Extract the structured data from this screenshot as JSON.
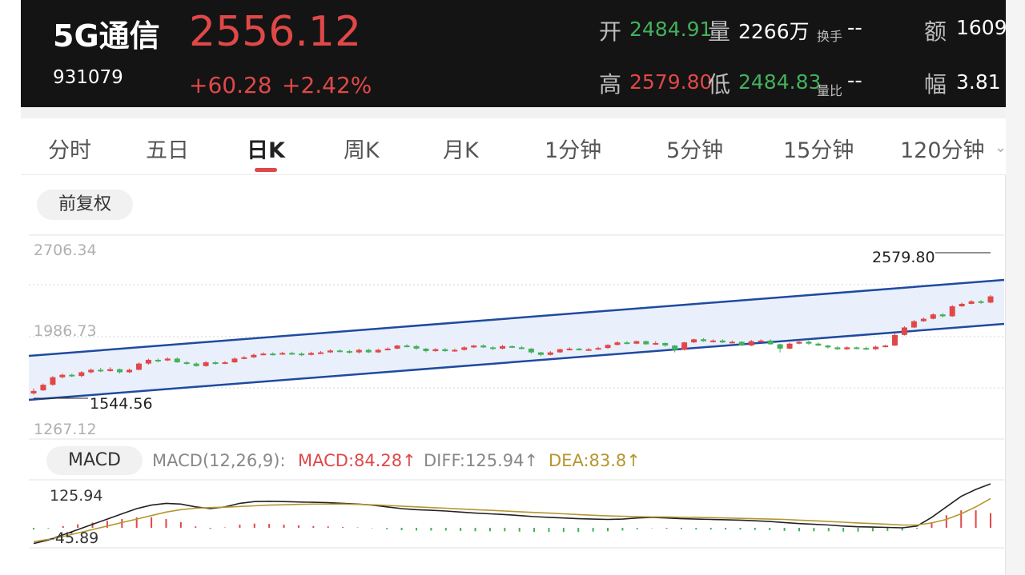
{
  "header": {
    "name": "5G通信",
    "code": "931079",
    "price": "2556.12",
    "change": "+60.28",
    "change_pct": "+2.42%",
    "open_label": "开",
    "open": "2484.91",
    "volume_label": "量",
    "volume": "2266万",
    "turnover_label": "换手",
    "turnover": "--",
    "amount_label": "额",
    "amount": "1609",
    "high_label": "高",
    "high": "2579.80",
    "low_label": "低",
    "low": "2484.83",
    "vol_ratio_label": "量比",
    "vol_ratio": "--",
    "amplitude_label": "幅",
    "amplitude": "3.81"
  },
  "tabs": [
    {
      "label": "分时"
    },
    {
      "label": "五日"
    },
    {
      "label": "日K",
      "active": true
    },
    {
      "label": "周K"
    },
    {
      "label": "月K"
    },
    {
      "label": "1分钟"
    },
    {
      "label": "5分钟"
    },
    {
      "label": "15分钟"
    },
    {
      "label": "120分钟"
    }
  ],
  "adjust": "前复权",
  "macd": {
    "label": "MACD",
    "params": "MACD(12,26,9):",
    "macd": "MACD:84.28↑",
    "diff": "DIFF:125.94↑",
    "dea": "DEA:83.8↑"
  },
  "colors": {
    "up": "#e04848",
    "down": "#44b05c",
    "channel": "#1f4aa0",
    "dea": "#b5962f"
  },
  "chart_data": {
    "type": "candlestick",
    "price_axis_labels": [
      "2706.34",
      "1986.73",
      "1267.12"
    ],
    "ylim": [
      1267.12,
      2706.34
    ],
    "max_marker": "2579.80",
    "min_marker": "1544.56",
    "candles": [
      [
        1550,
        1570,
        1540,
        1590
      ],
      [
        1575,
        1620,
        1570,
        1630
      ],
      [
        1620,
        1680,
        1610,
        1690
      ],
      [
        1680,
        1700,
        1670,
        1710
      ],
      [
        1700,
        1690,
        1680,
        1710
      ],
      [
        1690,
        1720,
        1680,
        1730
      ],
      [
        1720,
        1740,
        1710,
        1750
      ],
      [
        1740,
        1730,
        1720,
        1755
      ],
      [
        1730,
        1745,
        1725,
        1760
      ],
      [
        1745,
        1720,
        1710,
        1750
      ],
      [
        1720,
        1740,
        1715,
        1750
      ],
      [
        1740,
        1790,
        1735,
        1800
      ],
      [
        1790,
        1820,
        1780,
        1830
      ],
      [
        1820,
        1815,
        1800,
        1830
      ],
      [
        1815,
        1830,
        1810,
        1840
      ],
      [
        1830,
        1800,
        1795,
        1840
      ],
      [
        1800,
        1790,
        1780,
        1810
      ],
      [
        1790,
        1770,
        1765,
        1800
      ],
      [
        1770,
        1800,
        1765,
        1810
      ],
      [
        1800,
        1790,
        1780,
        1810
      ],
      [
        1790,
        1800,
        1785,
        1810
      ],
      [
        1800,
        1830,
        1795,
        1840
      ],
      [
        1830,
        1840,
        1825,
        1850
      ],
      [
        1840,
        1860,
        1835,
        1870
      ],
      [
        1860,
        1870,
        1855,
        1880
      ],
      [
        1870,
        1865,
        1855,
        1880
      ],
      [
        1865,
        1875,
        1860,
        1885
      ],
      [
        1875,
        1870,
        1860,
        1885
      ],
      [
        1870,
        1860,
        1850,
        1880
      ],
      [
        1860,
        1875,
        1855,
        1885
      ],
      [
        1875,
        1880,
        1870,
        1890
      ],
      [
        1880,
        1895,
        1875,
        1905
      ],
      [
        1895,
        1890,
        1880,
        1905
      ],
      [
        1890,
        1880,
        1870,
        1900
      ],
      [
        1880,
        1900,
        1870,
        1910
      ],
      [
        1900,
        1880,
        1875,
        1910
      ],
      [
        1880,
        1900,
        1875,
        1910
      ],
      [
        1900,
        1910,
        1895,
        1920
      ],
      [
        1910,
        1935,
        1905,
        1940
      ],
      [
        1935,
        1930,
        1920,
        1945
      ],
      [
        1930,
        1910,
        1900,
        1940
      ],
      [
        1910,
        1890,
        1880,
        1915
      ],
      [
        1890,
        1905,
        1885,
        1915
      ],
      [
        1905,
        1890,
        1885,
        1915
      ],
      [
        1890,
        1900,
        1885,
        1910
      ],
      [
        1900,
        1920,
        1895,
        1930
      ],
      [
        1920,
        1935,
        1915,
        1940
      ],
      [
        1935,
        1920,
        1915,
        1945
      ],
      [
        1920,
        1910,
        1900,
        1930
      ],
      [
        1910,
        1930,
        1905,
        1940
      ],
      [
        1930,
        1920,
        1915,
        1935
      ],
      [
        1920,
        1910,
        1905,
        1930
      ],
      [
        1910,
        1880,
        1870,
        1915
      ],
      [
        1880,
        1860,
        1850,
        1885
      ],
      [
        1860,
        1880,
        1855,
        1890
      ],
      [
        1880,
        1905,
        1875,
        1910
      ],
      [
        1905,
        1910,
        1895,
        1920
      ],
      [
        1910,
        1900,
        1895,
        1915
      ],
      [
        1900,
        1905,
        1895,
        1915
      ],
      [
        1905,
        1915,
        1900,
        1925
      ],
      [
        1915,
        1940,
        1910,
        1945
      ],
      [
        1940,
        1960,
        1935,
        1970
      ],
      [
        1960,
        1950,
        1945,
        1970
      ],
      [
        1950,
        1970,
        1945,
        1975
      ],
      [
        1970,
        1945,
        1940,
        1975
      ],
      [
        1945,
        1955,
        1940,
        1970
      ],
      [
        1955,
        1935,
        1925,
        1960
      ],
      [
        1935,
        1900,
        1880,
        1940
      ],
      [
        1900,
        1960,
        1895,
        1965
      ],
      [
        1960,
        1985,
        1955,
        1990
      ],
      [
        1985,
        1970,
        1965,
        1995
      ],
      [
        1970,
        1975,
        1960,
        1985
      ],
      [
        1975,
        1960,
        1955,
        1985
      ],
      [
        1960,
        1965,
        1955,
        1975
      ],
      [
        1965,
        1935,
        1930,
        1970
      ],
      [
        1935,
        1970,
        1930,
        1980
      ],
      [
        1970,
        1975,
        1965,
        1985
      ],
      [
        1975,
        1945,
        1940,
        1985
      ],
      [
        1945,
        1910,
        1880,
        1950
      ],
      [
        1910,
        1950,
        1905,
        1960
      ],
      [
        1950,
        1965,
        1945,
        1970
      ],
      [
        1965,
        1950,
        1940,
        1975
      ],
      [
        1950,
        1935,
        1930,
        1960
      ],
      [
        1935,
        1920,
        1910,
        1940
      ],
      [
        1920,
        1905,
        1900,
        1930
      ],
      [
        1905,
        1920,
        1900,
        1930
      ],
      [
        1920,
        1915,
        1905,
        1925
      ],
      [
        1915,
        1905,
        1900,
        1925
      ],
      [
        1905,
        1925,
        1900,
        1935
      ],
      [
        1925,
        1935,
        1920,
        1940
      ],
      [
        1935,
        2020,
        1930,
        2030
      ],
      [
        2020,
        2080,
        2015,
        2090
      ],
      [
        2080,
        2130,
        2075,
        2140
      ],
      [
        2130,
        2150,
        2125,
        2160
      ],
      [
        2150,
        2185,
        2145,
        2195
      ],
      [
        2185,
        2170,
        2160,
        2195
      ],
      [
        2170,
        2250,
        2165,
        2260
      ],
      [
        2250,
        2270,
        2245,
        2280
      ],
      [
        2270,
        2290,
        2265,
        2300
      ],
      [
        2290,
        2280,
        2270,
        2300
      ],
      [
        2280,
        2330,
        2275,
        2340
      ]
    ],
    "macd_axis_labels": [
      "125.94",
      "-45.89"
    ],
    "macd_ylim": [
      -45.89,
      125.94
    ],
    "diff": [
      -45,
      -35,
      -20,
      -5,
      10,
      25,
      40,
      55,
      65,
      70,
      68,
      60,
      55,
      60,
      70,
      75,
      76,
      75,
      74,
      73,
      72,
      70,
      68,
      65,
      60,
      55,
      52,
      50,
      48,
      45,
      42,
      40,
      38,
      35,
      32,
      30,
      28,
      26,
      25,
      24,
      25,
      28,
      30,
      28,
      26,
      25,
      24,
      23,
      22,
      20,
      18,
      15,
      12,
      10,
      8,
      5,
      3,
      2,
      1,
      0,
      5,
      30,
      60,
      90,
      110,
      125.94
    ],
    "dea": [
      -40,
      -33,
      -25,
      -15,
      -5,
      5,
      15,
      25,
      35,
      45,
      52,
      56,
      58,
      59,
      61,
      63,
      65,
      66,
      67,
      68,
      68,
      68,
      67,
      66,
      64,
      62,
      60,
      58,
      56,
      54,
      52,
      50,
      48,
      46,
      44,
      42,
      40,
      38,
      36,
      34,
      33,
      32,
      31,
      31,
      30,
      30,
      29,
      28,
      27,
      26,
      25,
      24,
      22,
      20,
      18,
      16,
      14,
      12,
      10,
      8,
      8,
      14,
      24,
      40,
      60,
      83.8
    ]
  }
}
